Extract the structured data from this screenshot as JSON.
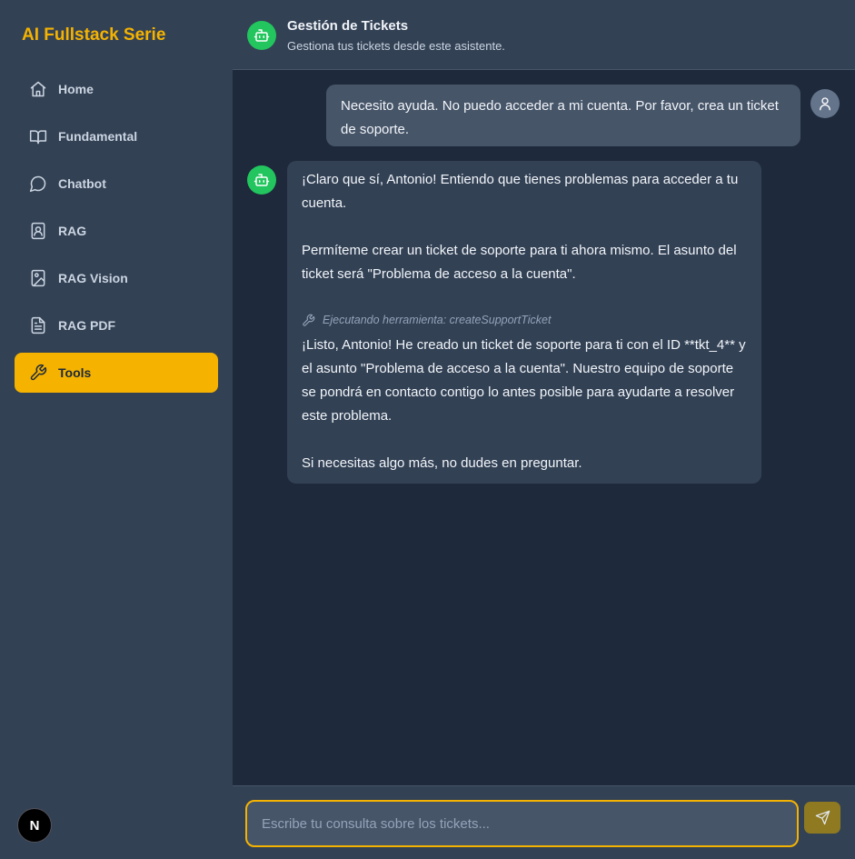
{
  "sidebar": {
    "brand": "AI Fullstack Serie",
    "items": [
      {
        "label": "Home",
        "icon": "home-icon"
      },
      {
        "label": "Fundamental",
        "icon": "book-icon"
      },
      {
        "label": "Chatbot",
        "icon": "chat-bubble-icon"
      },
      {
        "label": "RAG",
        "icon": "contact-book-icon"
      },
      {
        "label": "RAG Vision",
        "icon": "image-icon"
      },
      {
        "label": "RAG PDF",
        "icon": "file-text-icon"
      },
      {
        "label": "Tools",
        "icon": "wrench-icon",
        "active": true
      }
    ],
    "footer_logo": "N"
  },
  "header": {
    "title": "Gestión de Tickets",
    "subtitle": "Gestiona tus tickets desde este asistente.",
    "icon": "bot-icon"
  },
  "messages": {
    "user_1": "Necesito ayuda. No puedo acceder a mi cuenta. Por favor, crea un ticket de soporte.",
    "bot_1": {
      "p1": "¡Claro que sí, Antonio! Entiendo que tienes problemas para acceder a tu cuenta.",
      "p2": "Permíteme crear un ticket de soporte para ti ahora mismo. El asunto del ticket será \"Problema de acceso a la cuenta\".",
      "tool": "Ejecutando herramienta: createSupportTicket",
      "p3": "¡Listo, Antonio! He creado un ticket de soporte para ti con el ID **tkt_4** y el asunto \"Problema de acceso a la cuenta\". Nuestro equipo de soporte se pondrá en contacto contigo lo antes posible para ayudarte a resolver este problema.",
      "p4": "Si necesitas algo más, no dudes en preguntar."
    }
  },
  "composer": {
    "placeholder": "Escribe tu consulta sobre los tickets...",
    "value": ""
  },
  "colors": {
    "accent": "#f5b300",
    "sidebar_bg": "#334155",
    "chat_bg": "#1e293b",
    "bot_avatar": "#22c55e"
  }
}
